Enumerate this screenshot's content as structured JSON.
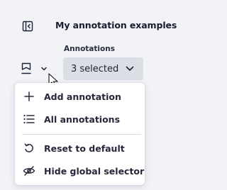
{
  "header": {
    "title": "My annotation examples",
    "collapse_icon": "sidebar-collapse-icon"
  },
  "annotations": {
    "label": "Annotations",
    "toggle_icon": "flag-icon",
    "selector": {
      "value": "3 selected",
      "icon": "chevron-down-icon"
    }
  },
  "menu": {
    "items": [
      {
        "label": "Add annotation",
        "icon": "plus-icon"
      },
      {
        "label": "All annotations",
        "icon": "list-icon"
      },
      {
        "label": "Reset to default",
        "icon": "reset-icon"
      },
      {
        "label": "Hide global selector",
        "icon": "eye-off-icon"
      }
    ]
  },
  "colors": {
    "background": "#f2f3f7",
    "selector_bg": "#dcdee6",
    "menu_bg": "#ffffff",
    "text": "#1a1c2e",
    "divider": "#d9dbe3"
  }
}
